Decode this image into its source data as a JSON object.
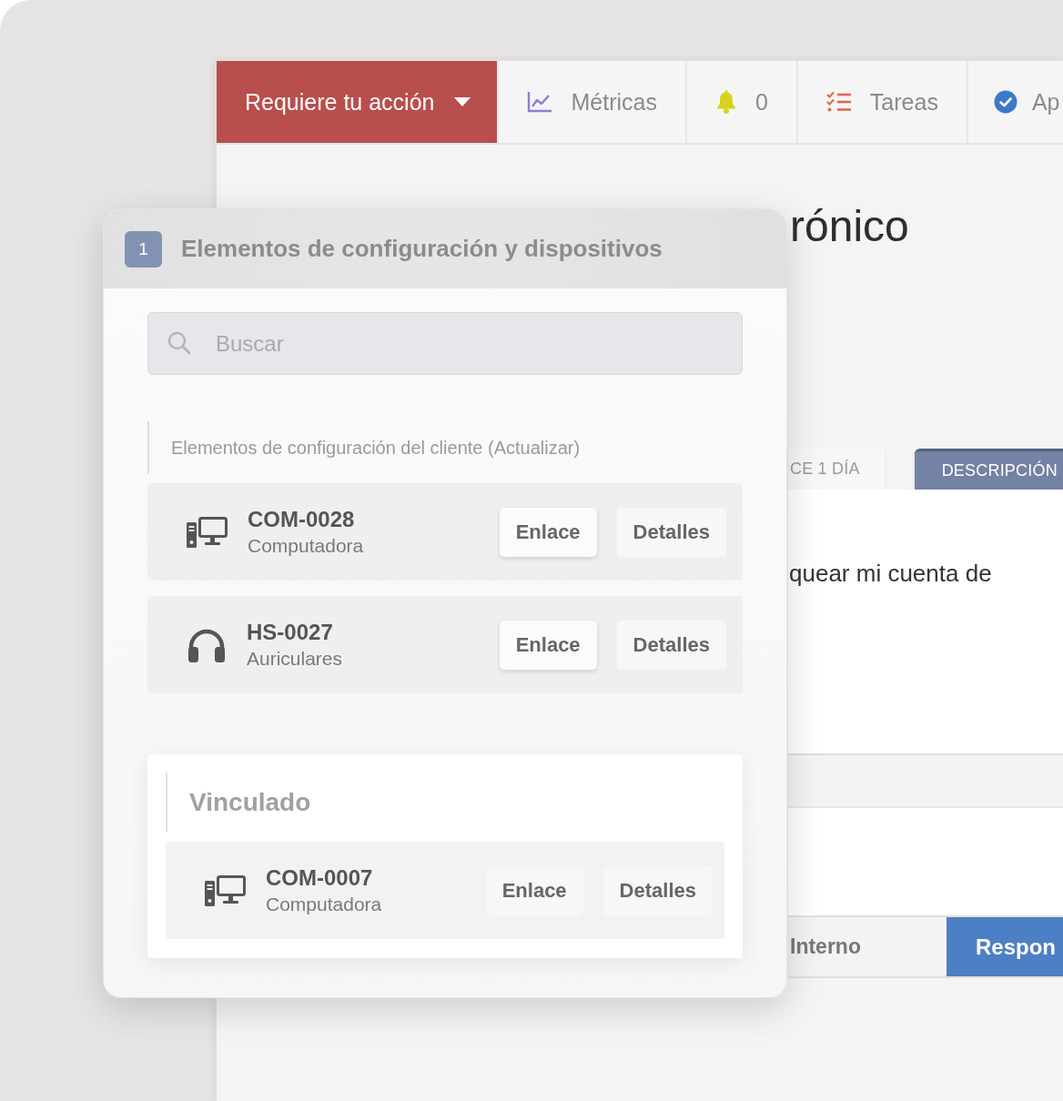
{
  "top_bar": {
    "tabs": [
      {
        "label": "Requiere tu acción",
        "kind": "menu",
        "selected": true
      },
      {
        "label": "Métricas",
        "kind": "chart",
        "selected": false
      },
      {
        "label": "0",
        "kind": "bell",
        "selected": false
      },
      {
        "label": "Tareas",
        "kind": "checklist",
        "selected": false
      },
      {
        "label": "Ap",
        "kind": "check",
        "selected": false
      }
    ]
  },
  "ticket": {
    "title": "rónico",
    "tabs": [
      {
        "label": "CE 1 DÍA",
        "selected": false
      },
      {
        "label": "DESCRIPCIÓN",
        "selected": true
      }
    ],
    "message": "quear mi cuenta de",
    "reply_tabs": [
      {
        "label": "Interno",
        "selected": false
      },
      {
        "label": "Respon",
        "selected": true
      }
    ]
  },
  "panel": {
    "badge": "1",
    "title": "Elementos de configuración y dispositivos",
    "search": {
      "placeholder": "Buscar"
    },
    "sections": [
      {
        "kind": "list",
        "heading": "Elementos de configuración del cliente (Actualizar)",
        "items": [
          {
            "kind": "computer",
            "name": "COM-0028",
            "category": "Computadora",
            "link_button": "Enlace",
            "details_button": "Detalles"
          },
          {
            "kind": "headphones",
            "name": "HS-0027",
            "category": "Auriculares",
            "link_button": "Enlace",
            "details_button": "Detalles"
          }
        ]
      },
      {
        "kind": "card",
        "heading": "Vinculado",
        "items": [
          {
            "kind": "computer",
            "name": "COM-0007",
            "category": "Computadora",
            "link_button": "Enlace",
            "details_button": "Detalles"
          }
        ]
      }
    ]
  }
}
